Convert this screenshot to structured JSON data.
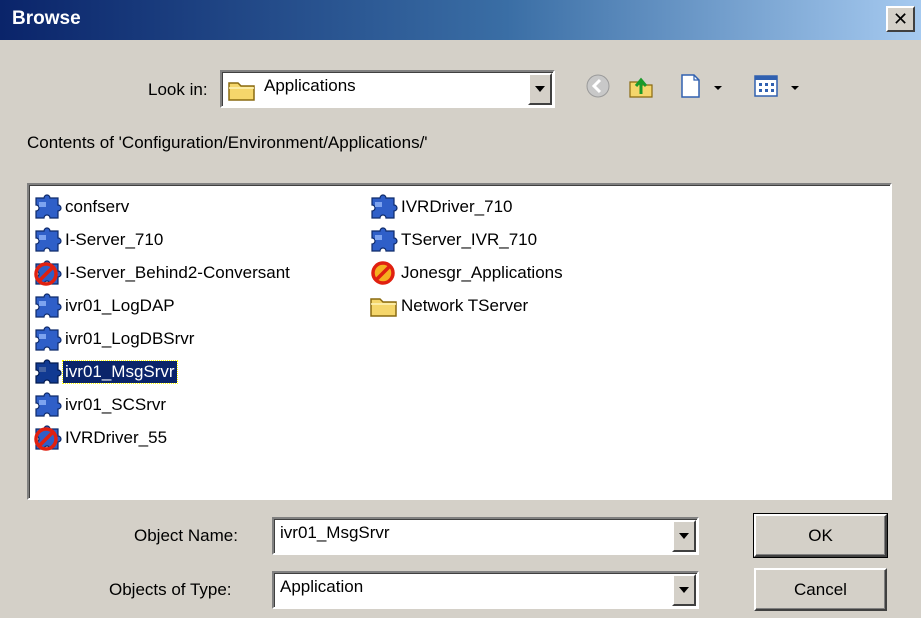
{
  "window": {
    "title": "Browse",
    "close_glyph": "✕"
  },
  "look_in": {
    "label": "Look in:",
    "value": "Applications",
    "icon": "folder-icon"
  },
  "toolbar": {
    "icons": [
      "back-icon",
      "up-folder-icon",
      "new-folder-icon",
      "view-menu-icon"
    ]
  },
  "contents_label": "Contents of 'Configuration/Environment/Applications/'",
  "file_list": {
    "column1": [
      {
        "name": "confserv",
        "icon": "application-icon",
        "state": "normal"
      },
      {
        "name": "I-Server_710",
        "icon": "application-icon",
        "state": "normal"
      },
      {
        "name": "I-Server_Behind2-Conversant",
        "icon": "disabled-application-icon",
        "state": "disabled"
      },
      {
        "name": "ivr01_LogDAP",
        "icon": "application-icon",
        "state": "normal"
      },
      {
        "name": "ivr01_LogDBSrvr",
        "icon": "application-icon",
        "state": "normal"
      },
      {
        "name": "ivr01_MsgSrvr",
        "icon": "application-icon",
        "state": "selected"
      },
      {
        "name": "ivr01_SCSrvr",
        "icon": "application-icon",
        "state": "normal"
      },
      {
        "name": "IVRDriver_55",
        "icon": "disabled-application-icon",
        "state": "disabled"
      }
    ],
    "column2": [
      {
        "name": "IVRDriver_710",
        "icon": "application-icon",
        "state": "normal"
      },
      {
        "name": "TServer_IVR_710",
        "icon": "application-icon",
        "state": "normal"
      },
      {
        "name": "Jonesgr_Applications",
        "icon": "disabled-folder-icon",
        "state": "disabled"
      },
      {
        "name": "Network TServer",
        "icon": "folder-icon",
        "state": "normal"
      }
    ]
  },
  "object_name": {
    "label": "Object Name:",
    "value": "ivr01_MsgSrvr"
  },
  "object_type": {
    "label": "Objects of Type:",
    "value": "Application"
  },
  "buttons": {
    "ok": "OK",
    "cancel": "Cancel"
  },
  "colors": {
    "title_bar": "#0a246a",
    "selection": "#0a246a",
    "face": "#d4d0c8",
    "app_icon_blue": "#2f5fc8",
    "forbidden_red": "#e02010",
    "folder_yellow": "#f5d66b"
  }
}
